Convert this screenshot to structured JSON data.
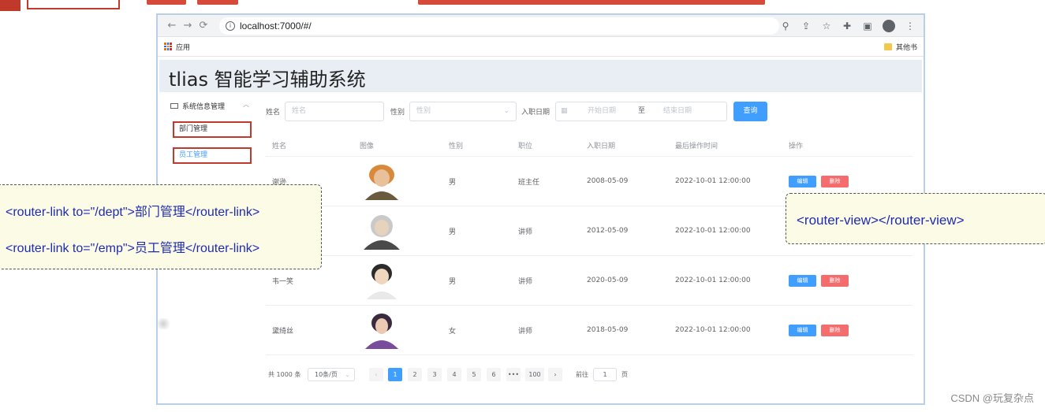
{
  "browser": {
    "url": "localhost:7000/#/",
    "bookmark_apps": "应用",
    "bookmark_other": "其他书"
  },
  "app": {
    "title": "tlias 智能学习辅助系统",
    "menu_group": "系统信息管理",
    "menu_items": [
      "部门管理",
      "员工管理"
    ]
  },
  "filter": {
    "name_label": "姓名",
    "name_placeholder": "姓名",
    "gender_label": "性别",
    "gender_placeholder": "性别",
    "entry_label": "入职日期",
    "start_placeholder": "开始日期",
    "range_sep": "至",
    "end_placeholder": "结束日期",
    "query_button": "查询"
  },
  "table": {
    "headers": [
      "姓名",
      "图像",
      "性别",
      "职位",
      "入职日期",
      "最后操作时间",
      "操作"
    ],
    "rows": [
      {
        "name": "谢逊",
        "gender": "男",
        "job": "班主任",
        "entry": "2008-05-09",
        "updated": "2022-10-01 12:00:00"
      },
      {
        "name": "",
        "gender": "男",
        "job": "讲师",
        "entry": "2012-05-09",
        "updated": "2022-10-01 12:00:00"
      },
      {
        "name": "韦一笑",
        "gender": "男",
        "job": "讲师",
        "entry": "2020-05-09",
        "updated": "2022-10-01 12:00:00"
      },
      {
        "name": "黛绮丝",
        "gender": "女",
        "job": "讲师",
        "entry": "2018-05-09",
        "updated": "2022-10-01 12:00:00"
      }
    ],
    "edit_label": "编辑",
    "delete_label": "删除"
  },
  "pager": {
    "total": "共 1000 条",
    "page_size": "10条/页",
    "prev": "‹",
    "pages": [
      "1",
      "2",
      "3",
      "4",
      "5",
      "6",
      "•••",
      "100"
    ],
    "next": "›",
    "goto_label": "前往",
    "goto_value": "1",
    "page_suffix": "页"
  },
  "callouts": {
    "left_line1": "<router-link to=\"/dept\">部门管理</router-link>",
    "left_line2": "<router-link to=\"/emp\">员工管理</router-link>",
    "right": "<router-view></router-view>"
  },
  "watermark": "CSDN @玩复杂点",
  "colors": {
    "primary": "#409eff",
    "danger": "#f56c6c",
    "highlight_border": "#c0392b",
    "callout_text": "#1f2bb3",
    "callout_bg": "#fcfbe6"
  }
}
